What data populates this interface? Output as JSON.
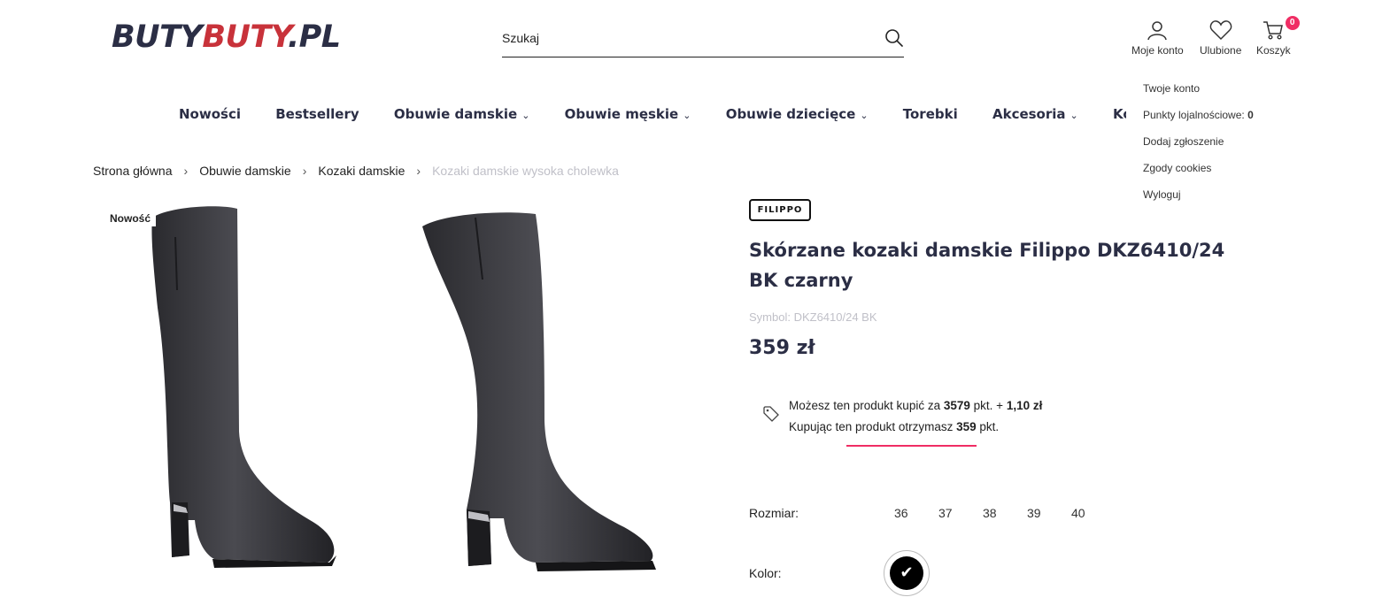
{
  "header": {
    "logo": {
      "part1": "BUTY",
      "part2": "BUTY",
      "part3": ".PL"
    },
    "search_placeholder": "Szukaj",
    "account_label": "Moje konto",
    "wishlist_label": "Ulubione",
    "cart_label": "Koszyk",
    "cart_count": "0"
  },
  "account_menu": {
    "items": [
      "Twoje konto",
      "Punkty lojalnościowe:",
      "Dodaj zgłoszenie",
      "Zgody cookies",
      "Wyloguj"
    ],
    "points_value": "0"
  },
  "nav": {
    "items": [
      {
        "label": "Nowości",
        "has_dropdown": false
      },
      {
        "label": "Bestsellery",
        "has_dropdown": false
      },
      {
        "label": "Obuwie damskie",
        "has_dropdown": true
      },
      {
        "label": "Obuwie męskie",
        "has_dropdown": true
      },
      {
        "label": "Obuwie dziecięce",
        "has_dropdown": true
      },
      {
        "label": "Torebki",
        "has_dropdown": false
      },
      {
        "label": "Akcesoria",
        "has_dropdown": true
      },
      {
        "label": "Kolekcja jesie",
        "has_dropdown": false
      }
    ]
  },
  "breadcrumb": {
    "items": [
      "Strona główna",
      "Obuwie damskie",
      "Kozaki damskie"
    ],
    "current": "Kozaki damskie wysoka cholewka"
  },
  "gallery": {
    "badge": "Nowość"
  },
  "product": {
    "brand_logo": "FILIPPO",
    "title": "Skórzane kozaki damskie Filippo DKZ6410/24 BK czarny",
    "symbol": "Symbol: DKZ6410/24 BK",
    "price": "359 zł",
    "points": {
      "line1_prefix": "Możesz ten produkt kupić za",
      "line1_points": "3579",
      "line1_mid": "pkt. +",
      "line1_cash": "1,10 zł",
      "line2_prefix": "Kupując ten produkt otrzymasz",
      "line2_points": "359",
      "line2_suffix": "pkt."
    },
    "size_label": "Rozmiar:",
    "sizes": [
      "36",
      "37",
      "38",
      "39",
      "40"
    ],
    "color_label": "Kolor:",
    "selected_color": "#000000"
  },
  "colors": {
    "accent": "#f02d64",
    "logo_dark": "#2b2e45",
    "logo_red": "#c8323a"
  }
}
